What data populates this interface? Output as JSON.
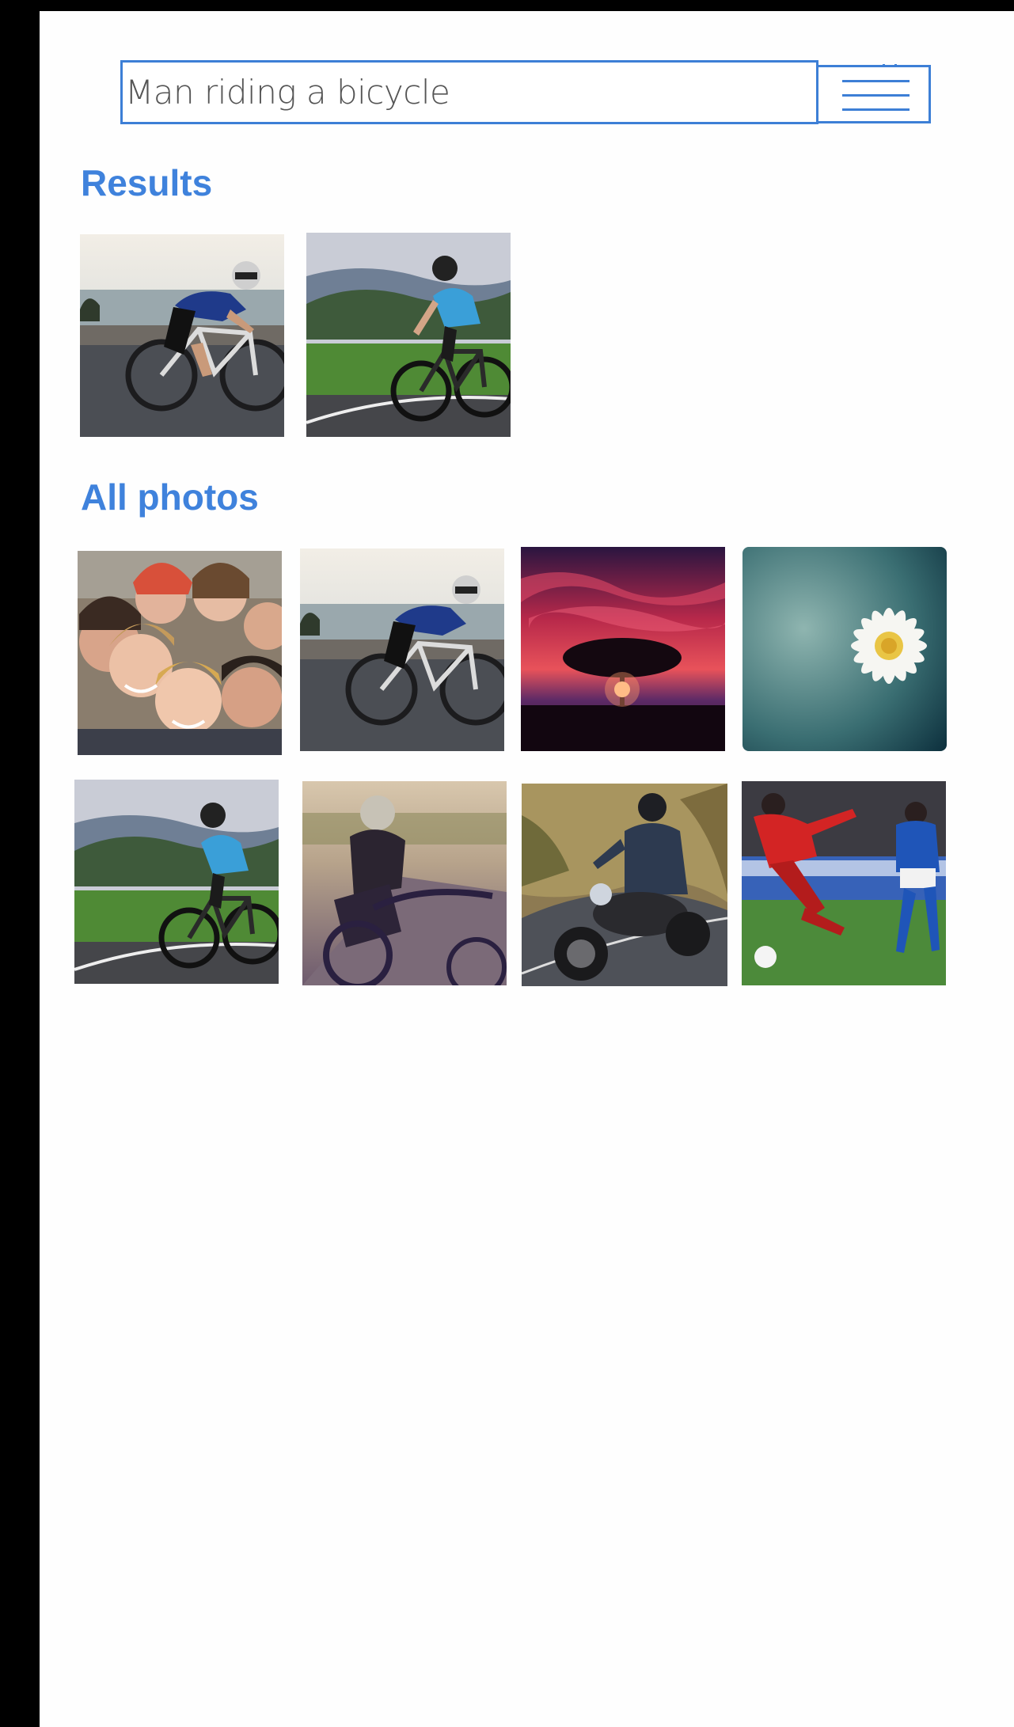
{
  "search": {
    "value": "Man riding a bicycle"
  },
  "menu": {
    "icon": "hamburger-menu-icon"
  },
  "sections": {
    "results_title": "Results",
    "all_photos_title": "All photos"
  },
  "results": [
    {
      "subject": "cyclist-coast-road"
    },
    {
      "subject": "cyclist-green-hills"
    }
  ],
  "all_photos": [
    {
      "subject": "group-selfie"
    },
    {
      "subject": "cyclist-coast-road"
    },
    {
      "subject": "tree-sunset"
    },
    {
      "subject": "daisy-flower"
    },
    {
      "subject": "cyclist-green-hills"
    },
    {
      "subject": "woman-cyclist"
    },
    {
      "subject": "motorcyclist"
    },
    {
      "subject": "soccer-players"
    }
  ],
  "colors": {
    "accent": "#3f82dc",
    "border": "#3d7fd6",
    "background": "#fefefe",
    "device": "#000000"
  }
}
